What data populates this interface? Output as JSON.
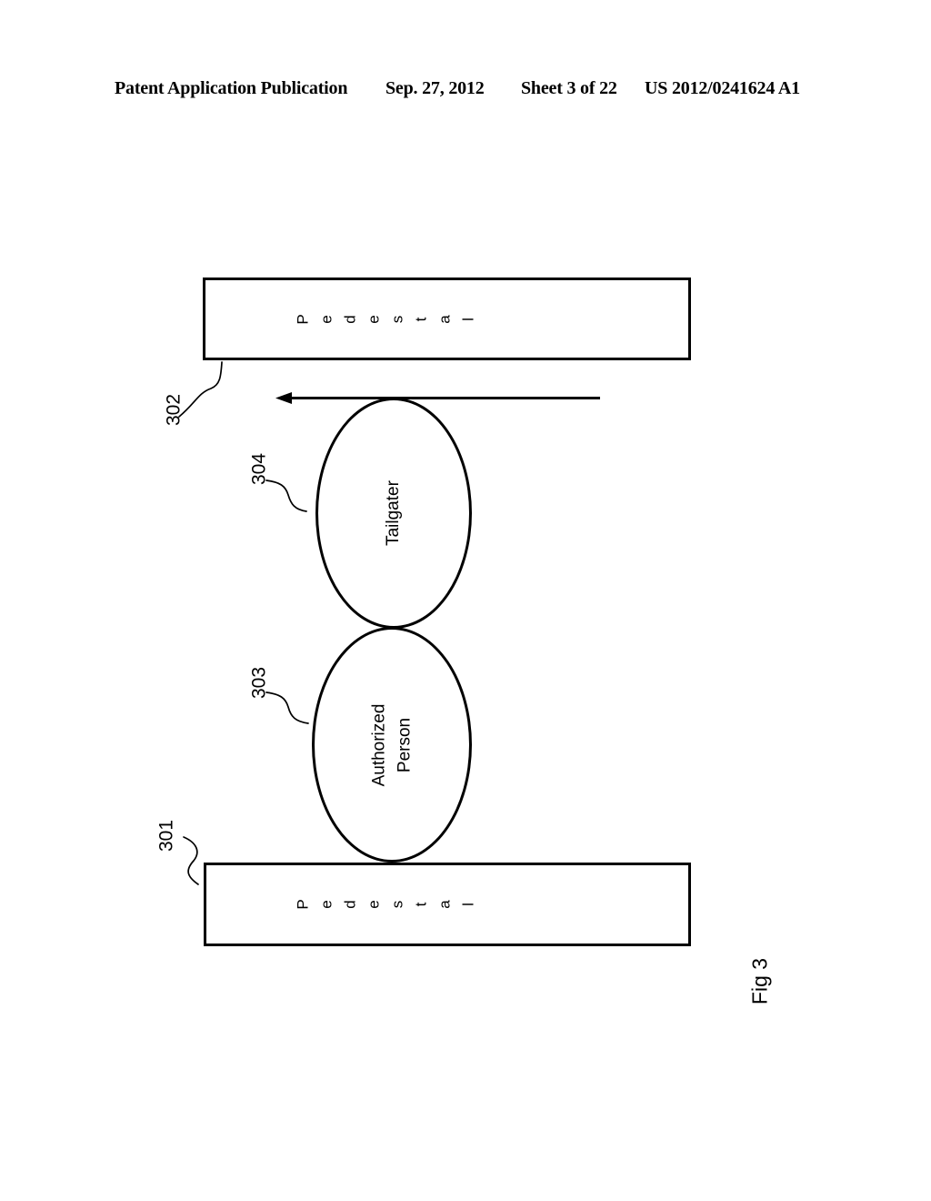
{
  "header": {
    "publication": "Patent Application Publication",
    "date": "Sep. 27, 2012",
    "sheet": "Sheet 3 of 22",
    "publication_number": "US 2012/0241624 A1"
  },
  "figure": {
    "caption": "Fig 3",
    "pedestal_top": {
      "ref": "302",
      "label": "Pedestal",
      "letters": [
        "P",
        "e",
        "d",
        "e",
        "s",
        "t",
        "a",
        "l"
      ]
    },
    "pedestal_bottom": {
      "ref": "301",
      "label": "Pedestal",
      "letters": [
        "P",
        "e",
        "d",
        "e",
        "s",
        "t",
        "a",
        "l"
      ]
    },
    "tailgater": {
      "ref": "304",
      "label": "Tailgater"
    },
    "authorized_person": {
      "ref": "303",
      "label_line1": "Authorized",
      "label_line2": "Person"
    },
    "direction_arrow": {
      "name": "direction-of-travel-arrow",
      "points": "left"
    },
    "line_color": "#000000",
    "background_color": "#ffffff"
  }
}
